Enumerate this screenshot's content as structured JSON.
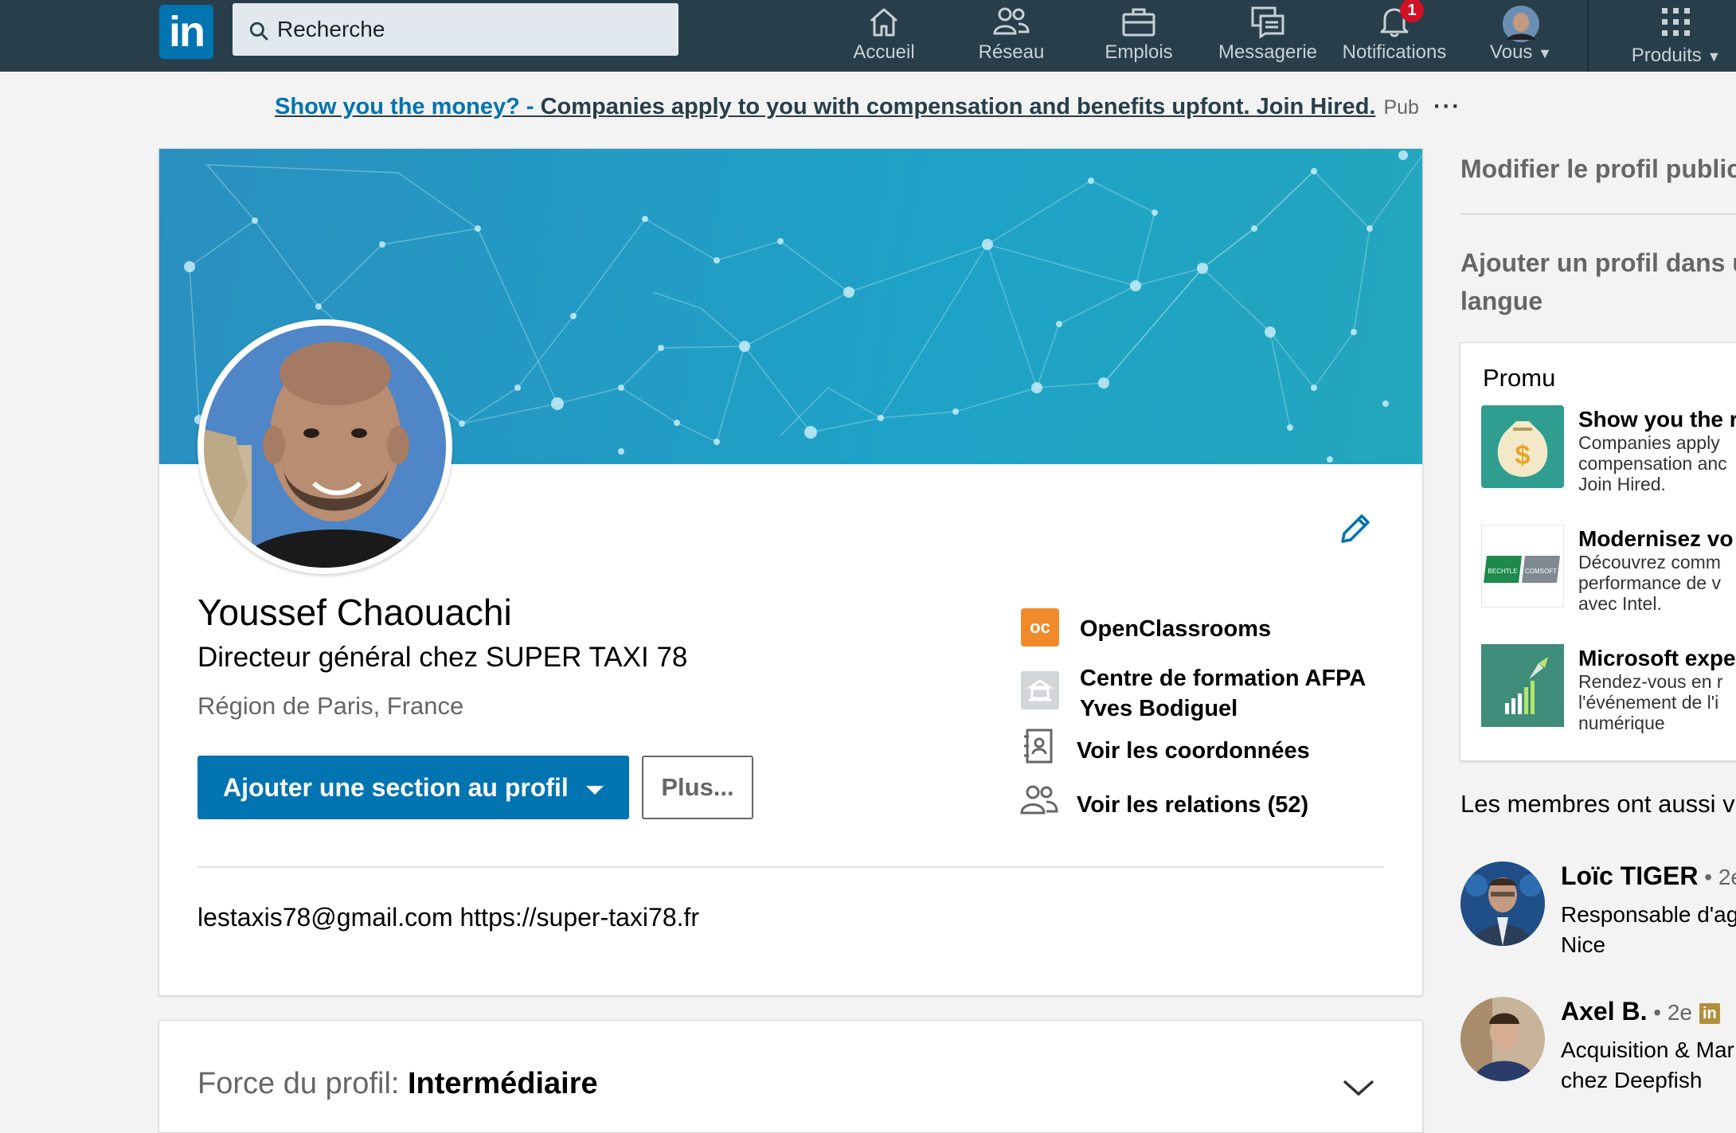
{
  "nav": {
    "search_placeholder": "Recherche",
    "items": [
      {
        "label": "Accueil",
        "icon": "home-icon"
      },
      {
        "label": "Réseau",
        "icon": "network-icon"
      },
      {
        "label": "Emplois",
        "icon": "jobs-icon"
      },
      {
        "label": "Messagerie",
        "icon": "messaging-icon"
      },
      {
        "label": "Notifications",
        "icon": "bell-icon",
        "badge": "1"
      },
      {
        "label": "Vous",
        "icon": "avatar"
      },
      {
        "label": "Produits",
        "icon": "grid-icon"
      }
    ]
  },
  "ad": {
    "link_blue": "Show you the money? - ",
    "link_text": "Companies apply to you with compensation and benefits upfont. Join Hired.",
    "pub": "Pub",
    "more": "···"
  },
  "profile": {
    "name": "Youssef Chaouachi",
    "headline": "Directeur général chez SUPER TAXI 78",
    "location": "Région de Paris, France",
    "add_section_button": "Ajouter une section au profil",
    "more_button": "Plus...",
    "contact_line": "lestaxis78@gmail.com https://super-taxi78.fr",
    "side": {
      "company": "OpenClassrooms",
      "school_line1": "Centre de formation AFPA",
      "school_line2": "Yves Bodiguel",
      "contact_link": "Voir les coordonnées",
      "relations_link": "Voir les relations (52)"
    }
  },
  "strength": {
    "label": "Force du profil: ",
    "value": "Intermédiaire"
  },
  "rail": {
    "edit_public": "Modifier le profil public",
    "add_lang_line1": "Ajouter un profil dans u",
    "add_lang_line2": "langue",
    "promo": {
      "title": "Promu",
      "items": [
        {
          "head": "Show you the r",
          "sub": [
            "Companies apply",
            "compensation anc",
            "Join Hired."
          ]
        },
        {
          "head": "Modernisez vo",
          "sub": [
            "Découvrez comm",
            "performance de v",
            "avec Intel."
          ]
        },
        {
          "head": "Microsoft expe",
          "sub": [
            "Rendez-vous en r",
            "l'événement de l'i",
            "numérique"
          ]
        }
      ]
    },
    "also_viewed": "Les membres ont aussi v",
    "people": [
      {
        "name": "Loïc TIGER",
        "degree": " • 2e",
        "sub": [
          "Responsable d'ag",
          "Nice"
        ]
      },
      {
        "name": "Axel B.",
        "degree": " • 2e",
        "sub": [
          "Acquisition & Mar",
          "chez Deepfish"
        ]
      }
    ]
  },
  "colors": {
    "nav_bg": "#283e4a",
    "brand_blue": "#0073b1",
    "badge_red": "#d11124"
  }
}
